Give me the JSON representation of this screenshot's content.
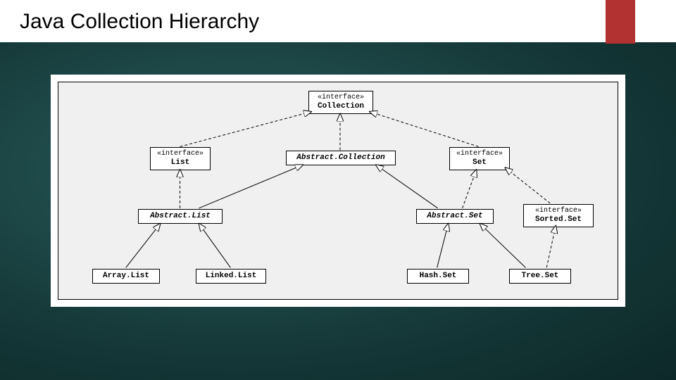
{
  "title": "Java Collection Hierarchy",
  "nodes": {
    "collection": {
      "stereotype": "«interface»",
      "name": "Collection"
    },
    "list": {
      "stereotype": "«interface»",
      "name": "List"
    },
    "abstractCollection": {
      "name": "Abstract.Collection"
    },
    "set": {
      "stereotype": "«interface»",
      "name": "Set"
    },
    "abstractList": {
      "name": "Abstract.List"
    },
    "abstractSet": {
      "name": "Abstract.Set"
    },
    "sortedSet": {
      "stereotype": "«interface»",
      "name": "Sorted.Set"
    },
    "arrayList": {
      "name": "Array.List"
    },
    "linkedList": {
      "name": "Linked.List"
    },
    "hashSet": {
      "name": "Hash.Set"
    },
    "treeSet": {
      "name": "Tree.Set"
    }
  },
  "edges": [
    {
      "from": "list",
      "to": "collection",
      "style": "dashed"
    },
    {
      "from": "abstractCollection",
      "to": "collection",
      "style": "dashed"
    },
    {
      "from": "set",
      "to": "collection",
      "style": "dashed"
    },
    {
      "from": "abstractList",
      "to": "list",
      "style": "dashed"
    },
    {
      "from": "abstractList",
      "to": "abstractCollection",
      "style": "solid"
    },
    {
      "from": "abstractSet",
      "to": "abstractCollection",
      "style": "solid"
    },
    {
      "from": "abstractSet",
      "to": "set",
      "style": "dashed"
    },
    {
      "from": "sortedSet",
      "to": "set",
      "style": "dashed"
    },
    {
      "from": "arrayList",
      "to": "abstractList",
      "style": "solid"
    },
    {
      "from": "linkedList",
      "to": "abstractList",
      "style": "solid"
    },
    {
      "from": "hashSet",
      "to": "abstractSet",
      "style": "solid"
    },
    {
      "from": "treeSet",
      "to": "abstractSet",
      "style": "solid"
    },
    {
      "from": "treeSet",
      "to": "sortedSet",
      "style": "dashed"
    }
  ]
}
